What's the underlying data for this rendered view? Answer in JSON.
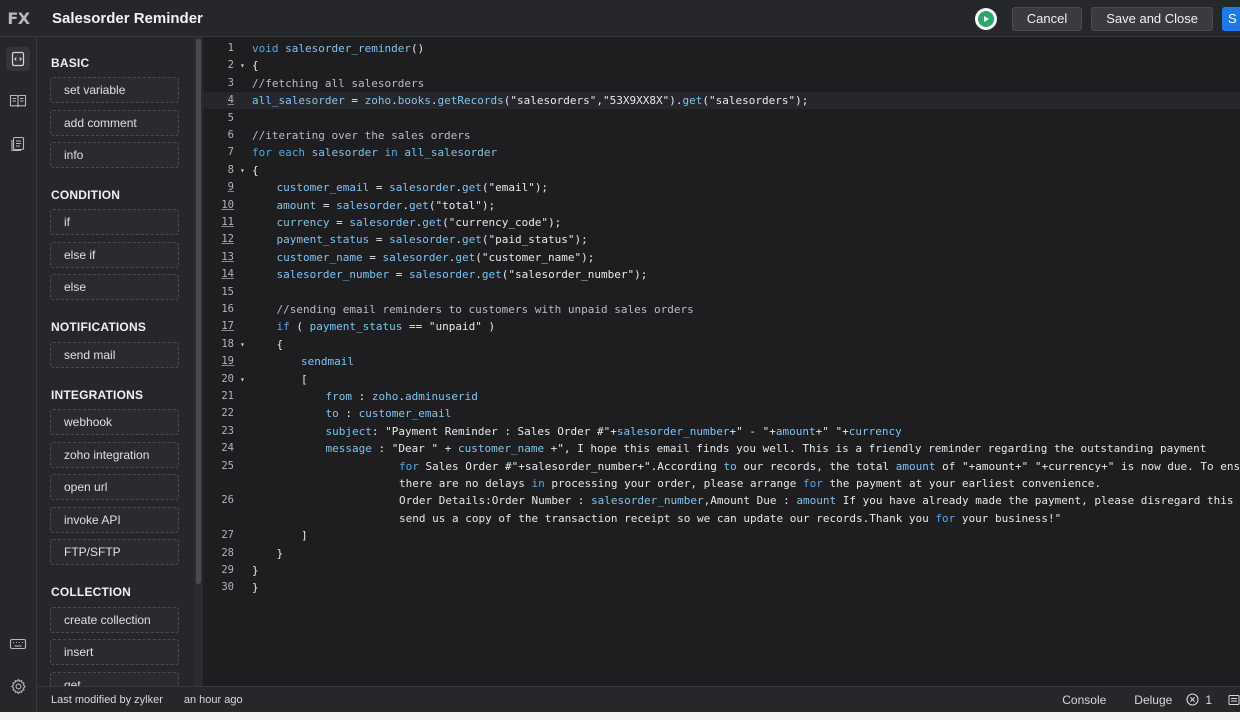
{
  "header": {
    "logo": "FX",
    "title": "Salesorder Reminder",
    "cancel_label": "Cancel",
    "save_close_label": "Save and Close",
    "save_label": "S",
    "run_icon": "play-icon"
  },
  "rail": {
    "icons": [
      "code-file-icon",
      "snippets-book-icon",
      "list-doc-icon",
      "keyboard-icon",
      "settings-gear-icon"
    ]
  },
  "panel": {
    "sections": [
      {
        "title": "BASIC",
        "items": [
          "set variable",
          "add comment",
          "info"
        ]
      },
      {
        "title": "CONDITION",
        "items": [
          "if",
          "else if",
          "else"
        ]
      },
      {
        "title": "NOTIFICATIONS",
        "items": [
          "send mail"
        ]
      },
      {
        "title": "INTEGRATIONS",
        "items": [
          "webhook",
          "zoho integration",
          "open url",
          "invoke API",
          "FTP/SFTP"
        ]
      },
      {
        "title": "COLLECTION",
        "items": [
          "create collection",
          "insert",
          "get"
        ]
      }
    ]
  },
  "editor": {
    "lines": [
      {
        "n": "1",
        "fold": "",
        "u": false,
        "indent": 0,
        "text": "void salesorder_reminder()"
      },
      {
        "n": "2",
        "fold": "▾",
        "u": false,
        "indent": 0,
        "text": "{"
      },
      {
        "n": "3",
        "fold": "",
        "u": false,
        "indent": 0,
        "text": "//fetching all salesorders"
      },
      {
        "n": "4",
        "fold": "",
        "u": true,
        "indent": 0,
        "text": "all_salesorder = zoho.books.getRecords(\"salesorders\",\"53X9XX8X\").get(\"salesorders\");"
      },
      {
        "n": "5",
        "fold": "",
        "u": false,
        "indent": 0,
        "text": ""
      },
      {
        "n": "6",
        "fold": "",
        "u": false,
        "indent": 0,
        "text": "//iterating over the sales orders"
      },
      {
        "n": "7",
        "fold": "",
        "u": false,
        "indent": 0,
        "text": "for each salesorder in all_salesorder"
      },
      {
        "n": "8",
        "fold": "▾",
        "u": false,
        "indent": 0,
        "text": "{"
      },
      {
        "n": "9",
        "fold": "",
        "u": true,
        "indent": 1,
        "text": "customer_email = salesorder.get(\"email\");"
      },
      {
        "n": "10",
        "fold": "",
        "u": true,
        "indent": 1,
        "text": "amount = salesorder.get(\"total\");"
      },
      {
        "n": "11",
        "fold": "",
        "u": true,
        "indent": 1,
        "text": "currency = salesorder.get(\"currency_code\");"
      },
      {
        "n": "12",
        "fold": "",
        "u": true,
        "indent": 1,
        "text": "payment_status = salesorder.get(\"paid_status\");"
      },
      {
        "n": "13",
        "fold": "",
        "u": true,
        "indent": 1,
        "text": "customer_name = salesorder.get(\"customer_name\");"
      },
      {
        "n": "14",
        "fold": "",
        "u": true,
        "indent": 1,
        "text": "salesorder_number = salesorder.get(\"salesorder_number\");"
      },
      {
        "n": "15",
        "fold": "",
        "u": false,
        "indent": 0,
        "text": ""
      },
      {
        "n": "16",
        "fold": "",
        "u": false,
        "indent": 1,
        "text": "//sending email reminders to customers with unpaid sales orders"
      },
      {
        "n": "17",
        "fold": "",
        "u": true,
        "indent": 1,
        "text": "if ( payment_status == \"unpaid\" )"
      },
      {
        "n": "18",
        "fold": "▾",
        "u": false,
        "indent": 1,
        "text": "{"
      },
      {
        "n": "19",
        "fold": "",
        "u": true,
        "indent": 2,
        "text": "sendmail"
      },
      {
        "n": "20",
        "fold": "▾",
        "u": false,
        "indent": 2,
        "text": "["
      },
      {
        "n": "21",
        "fold": "",
        "u": false,
        "indent": 3,
        "text": "from : zoho.adminuserid"
      },
      {
        "n": "22",
        "fold": "",
        "u": false,
        "indent": 3,
        "text": "to : customer_email"
      },
      {
        "n": "23",
        "fold": "",
        "u": false,
        "indent": 3,
        "text": "subject: \"Payment Reminder : Sales Order #\"+salesorder_number+\" - \"+amount+\" \"+currency"
      },
      {
        "n": "24",
        "fold": "",
        "u": false,
        "indent": 3,
        "text": "message : \"Dear \" + customer_name +\", I hope this email finds you well. This is a friendly reminder regarding the outstanding payment"
      },
      {
        "n": "25",
        "fold": "",
        "u": false,
        "indent": 6,
        "text": "for Sales Order #\"+salesorder_number+\".According to our records, the total amount of \"+amount+\" \"+currency+\" is now due. To ensure"
      },
      {
        "n": "",
        "fold": "",
        "u": false,
        "indent": 6,
        "text": "there are no delays in processing your order, please arrange for the payment at your earliest convenience."
      },
      {
        "n": "26",
        "fold": "",
        "u": false,
        "indent": 6,
        "text": "Order Details:Order Number : salesorder_number,Amount Due : amount If you have already made the payment, please disregard this email or"
      },
      {
        "n": "",
        "fold": "",
        "u": false,
        "indent": 6,
        "text": "send us a copy of the transaction receipt so we can update our records.Thank you for your business!\""
      },
      {
        "n": "27",
        "fold": "",
        "u": false,
        "indent": 2,
        "text": "]"
      },
      {
        "n": "28",
        "fold": "",
        "u": false,
        "indent": 1,
        "text": "}"
      },
      {
        "n": "29",
        "fold": "",
        "u": false,
        "indent": 0,
        "text": "}"
      },
      {
        "n": "30",
        "fold": "",
        "u": false,
        "indent": 0,
        "text": "}"
      }
    ]
  },
  "status": {
    "modified_by": "Last modified by zylker",
    "modified_time": "an hour ago",
    "console_label": "Console",
    "deluge_label": "Deluge",
    "error_count": "1"
  }
}
